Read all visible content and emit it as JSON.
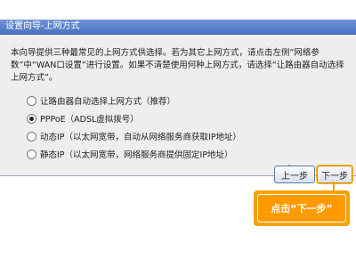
{
  "window": {
    "title": "设置向导-上网方式"
  },
  "description": "本向导提供三种最常见的上网方式供选择。若为其它上网方式，请点击左侧“网络参数”中“WAN口设置”进行设置。如果不清楚使用何种上网方式，请选择“让路由器自动选择上网方式”。",
  "options": [
    {
      "label": "让路由器自动选择上网方式（推荐）",
      "checked": false
    },
    {
      "label": "PPPoE（ADSL虚拟拨号）",
      "checked": true
    },
    {
      "label": "动态IP（以太网宽带，自动从网络服务商获取IP地址）",
      "checked": false
    },
    {
      "label": "静态IP（以太网宽带，网络服务商提供固定IP地址）",
      "checked": false
    }
  ],
  "buttons": {
    "prev_label": "上一步",
    "next_label": "下一步"
  },
  "callout": {
    "text": "点击“下一步”"
  },
  "colors": {
    "titlebar": "#4a73c3",
    "panel": "#eeeeee",
    "callout": "#ff9a00"
  }
}
